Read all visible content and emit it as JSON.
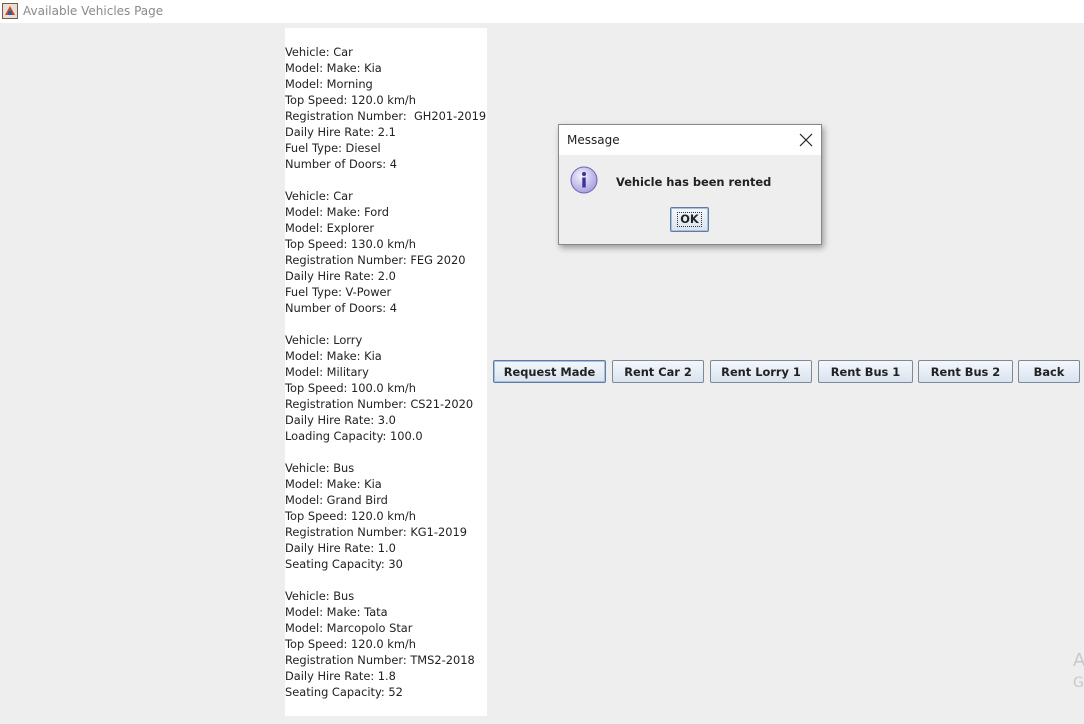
{
  "window": {
    "title": "Available Vehicles Page"
  },
  "vehicles": [
    {
      "lines": [
        "Vehicle: Car",
        "Model: Make: Kia",
        "Model: Morning",
        "Top Speed: 120.0 km/h",
        "Registration Number:  GH201-2019",
        "Daily Hire Rate: 2.1",
        "Fuel Type: Diesel",
        "Number of Doors: 4"
      ]
    },
    {
      "lines": [
        "Vehicle: Car",
        "Model: Make: Ford",
        "Model: Explorer",
        "Top Speed: 130.0 km/h",
        "Registration Number: FEG 2020",
        "Daily Hire Rate: 2.0",
        "Fuel Type: V-Power",
        "Number of Doors: 4"
      ]
    },
    {
      "lines": [
        "Vehicle: Lorry",
        "Model: Make: Kia",
        "Model: Military",
        "Top Speed: 100.0 km/h",
        "Registration Number: CS21-2020",
        "Daily Hire Rate: 3.0",
        "Loading Capacity: 100.0"
      ]
    },
    {
      "lines": [
        "Vehicle: Bus",
        "Model: Make: Kia",
        "Model: Grand Bird",
        "Top Speed: 120.0 km/h",
        "Registration Number: KG1-2019",
        "Daily Hire Rate: 1.0",
        "Seating Capacity: 30"
      ]
    },
    {
      "lines": [
        "Vehicle: Bus",
        "Model: Make: Tata",
        "Model: Marcopolo Star",
        "Top Speed: 120.0 km/h",
        "Registration Number: TMS2-2018",
        "Daily Hire Rate: 1.8",
        "Seating Capacity: 52"
      ]
    }
  ],
  "buttons": {
    "request_made": "Request Made",
    "rent_car_2": "Rent Car 2",
    "rent_lorry_1": "Rent Lorry 1",
    "rent_bus_1": "Rent Bus 1",
    "rent_bus_2": "Rent Bus 2",
    "back": "Back"
  },
  "dialog": {
    "title": "Message",
    "message": "Vehicle has been rented",
    "ok_label": "OK"
  },
  "watermark": {
    "line1": "A",
    "line2": "G"
  },
  "icons": {
    "app": "java-app-icon",
    "dialog_info": "info-icon",
    "dialog_close": "close-icon"
  }
}
